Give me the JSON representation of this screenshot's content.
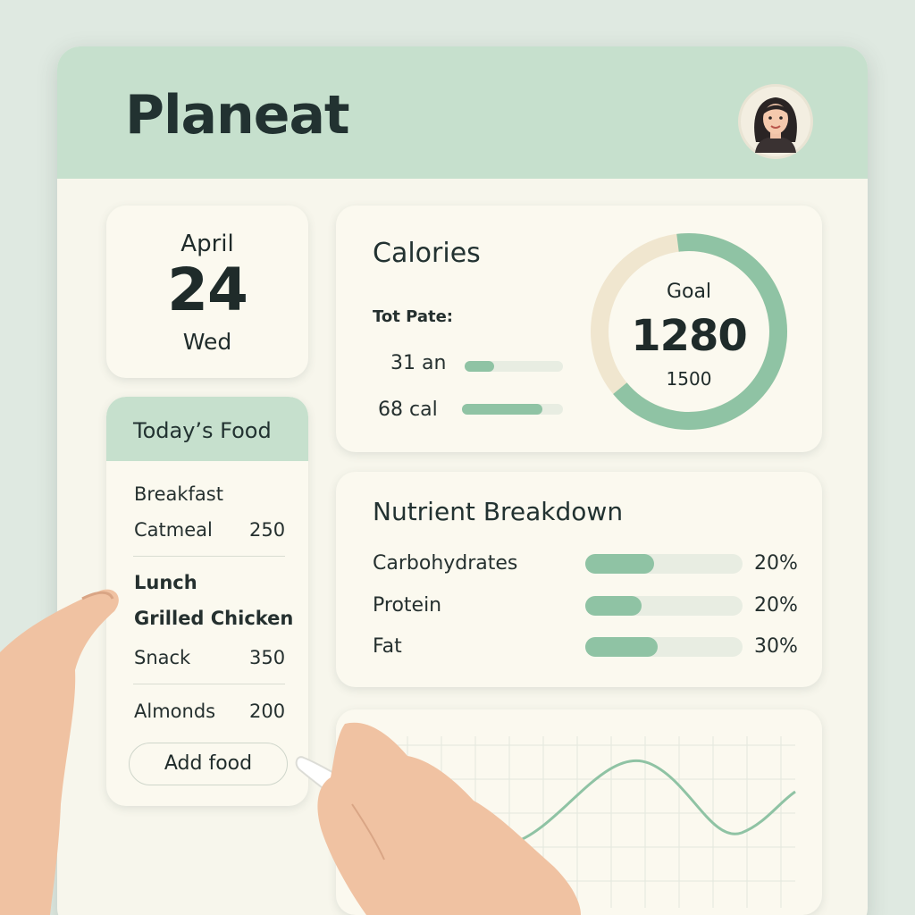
{
  "app": {
    "title": "Planeat"
  },
  "header": {
    "avatar_icon": "user-avatar-icon"
  },
  "date": {
    "month": "April",
    "day": "24",
    "weekday": "Wed"
  },
  "today_food": {
    "title": "Today’s Food",
    "items": [
      {
        "text": "Breakfast",
        "value": ""
      },
      {
        "text": "Catmeal",
        "value": "250"
      },
      {
        "text": "Lunch",
        "value": ""
      },
      {
        "text": "Grilled Chicken",
        "value": ""
      },
      {
        "text": "Snack",
        "value": "350"
      },
      {
        "text": "Almonds",
        "value": "200"
      }
    ],
    "add_button": "Add food"
  },
  "calories": {
    "title": "Calories",
    "subtitle": "Tot Pate:",
    "rows": [
      {
        "label": "31 an",
        "fill": 0.3
      },
      {
        "label": "68 cal",
        "fill": 0.8
      }
    ],
    "goal_label": "Goal",
    "goal_value": "1280",
    "goal_target": "1500",
    "ring_progress": 0.66
  },
  "nutrients": {
    "title": "Nutrient Breakdown",
    "items": [
      {
        "label": "Carbohydrates",
        "percent": "20%",
        "fill": 0.44
      },
      {
        "label": "Protein",
        "percent": "20%",
        "fill": 0.36
      },
      {
        "label": "Fat",
        "percent": "30%",
        "fill": 0.46
      }
    ]
  },
  "colors": {
    "accent": "#8fc3a4",
    "header": "#c6e0cd",
    "card": "#fbf9ef",
    "ring_track": "#f0e6cf"
  }
}
